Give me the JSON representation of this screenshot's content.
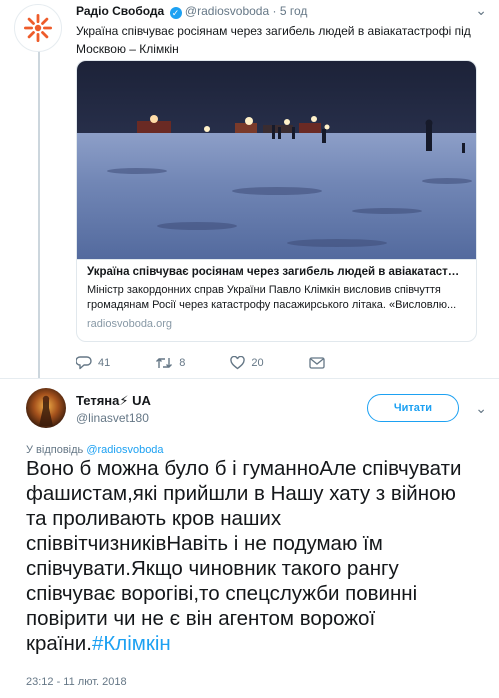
{
  "parent_tweet": {
    "author_name": "Радіо Свобода",
    "handle": "@radiosvoboda",
    "separator": "·",
    "time": "5 год",
    "text": "Україна співчуває росіянам через загибель людей в авіакатастрофі під Москвою – Клімкін",
    "card": {
      "title": "Україна співчуває росіянам через загибель людей в авіакатастро...",
      "description": "Міністр закордонних справ України Павло Клімкін висловив співчуття громадянам Росії через катастрофу пасажирського літака. «Висловлю...",
      "domain": "radiosvoboda.org"
    },
    "actions": {
      "replies": "41",
      "retweets": "8",
      "likes": "20"
    },
    "colors": {
      "brand": "#ee5c2b",
      "like": "#657786"
    }
  },
  "reply_tweet": {
    "author_name": "Тетяна⚡ UA",
    "handle": "@linasvet180",
    "follow_label": "Читати",
    "reply_prefix": "У відповідь",
    "reply_mention": "@radiosvoboda",
    "text": "Воно б можна було б і гуманноАле співчувати фашистам,які прийшли в Нашу хату з війною та проливають кров наших співвітчизниківНавіть і не подумаю їм співчувати.Якщо чиновник такого рангу співчуває ворогіві,то спецслужби повинні повірити чи не є він агентом ворожої країни.",
    "hashtag": "#Клімкін",
    "timestamp": "23:12 - 11 лют. 2018"
  },
  "icons": {
    "logo": "radio-svoboda-logo-icon",
    "verified": "verified-badge-icon",
    "caret": "chevron-down-icon",
    "reply": "reply-icon",
    "retweet": "retweet-icon",
    "like": "heart-icon",
    "dm": "envelope-icon"
  },
  "accent_color": "#1da1f2"
}
